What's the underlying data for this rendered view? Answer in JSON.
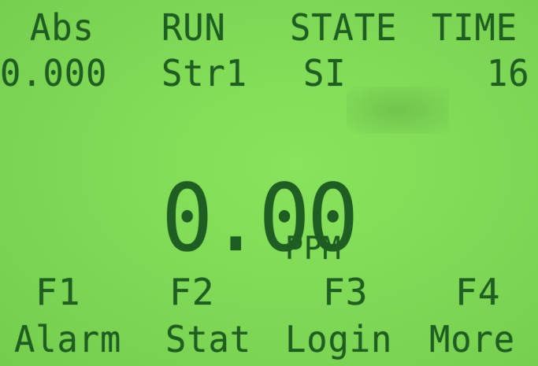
{
  "header": {
    "abs_label": "Abs",
    "run_label": "RUN",
    "state_label": "STATE",
    "time_label": "TIME"
  },
  "status": {
    "abs_value": "0.000",
    "run_value": "Str1",
    "state_value": "SI",
    "time_value": "16"
  },
  "reading": {
    "value": "0.00",
    "unit": "PPM"
  },
  "function_keys": [
    {
      "key": "F1",
      "label": "Alarm"
    },
    {
      "key": "F2",
      "label": "Stat"
    },
    {
      "key": "F3",
      "label": "Login"
    },
    {
      "key": "F4",
      "label": "More"
    }
  ],
  "colors": {
    "background": "#7ed855",
    "text": "#1f5e22"
  }
}
